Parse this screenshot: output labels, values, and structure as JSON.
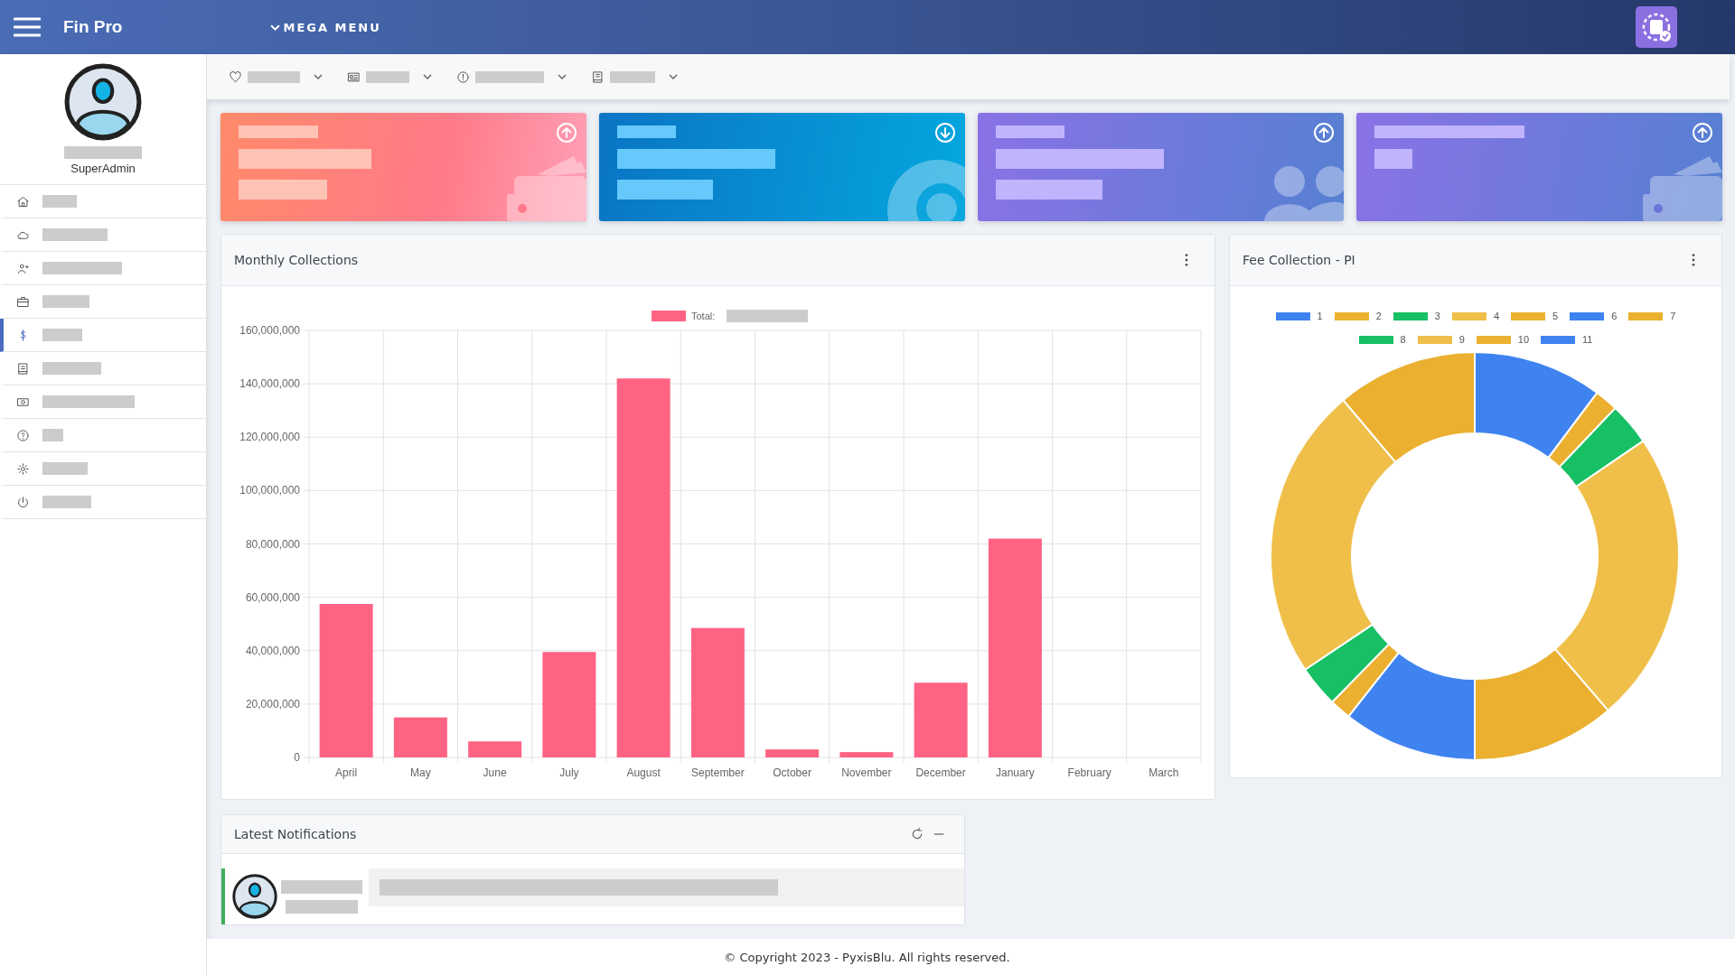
{
  "header": {
    "brand": "Fin Pro",
    "mega_menu": "MEGA MENU"
  },
  "profile": {
    "role": "SuperAdmin"
  },
  "sidebar": {
    "items": [
      {
        "selected": false
      },
      {
        "selected": false
      },
      {
        "selected": false
      },
      {
        "selected": false
      },
      {
        "selected": true
      },
      {
        "selected": false
      },
      {
        "selected": false
      },
      {
        "selected": false
      },
      {
        "selected": false
      },
      {
        "selected": false
      }
    ]
  },
  "cards": [
    {
      "up": true
    },
    {
      "up": false
    },
    {
      "up": true
    },
    {
      "up": true
    }
  ],
  "monthly_collections": {
    "title": "Monthly Collections",
    "chart_data": {
      "type": "bar",
      "categories": [
        "April",
        "May",
        "June",
        "July",
        "August",
        "September",
        "October",
        "November",
        "December",
        "January",
        "February",
        "March"
      ],
      "series": [
        {
          "name": "Total:",
          "color": "#ff6384",
          "values": [
            57500000,
            15000000,
            6000000,
            39500000,
            142000000,
            48500000,
            3000000,
            2000000,
            28000000,
            82000000,
            0,
            0
          ]
        }
      ],
      "ylim": [
        0,
        160000000
      ],
      "grid": true,
      "yticks": [
        {
          "value": 0,
          "label": "0"
        },
        {
          "value": 20000000,
          "label": "20,000,000"
        },
        {
          "value": 40000000,
          "label": "40,000,000"
        },
        {
          "value": 60000000,
          "label": "60,000,000"
        },
        {
          "value": 80000000,
          "label": "80,000,000"
        },
        {
          "value": 100000000,
          "label": "100,000,000"
        },
        {
          "value": 120000000,
          "label": "120,000,000"
        },
        {
          "value": 140000000,
          "label": "140,000,000"
        },
        {
          "value": 160000000,
          "label": "160,000,000"
        }
      ]
    }
  },
  "fee_collection": {
    "title": "Fee Collection - PI",
    "legend": [
      {
        "label": "1",
        "color": "#3f83f0"
      },
      {
        "label": "2",
        "color": "#ebb030"
      },
      {
        "label": "3",
        "color": "#17c064"
      },
      {
        "label": "4",
        "color": "#efbf4a"
      },
      {
        "label": "5",
        "color": "#ebb030"
      },
      {
        "label": "6",
        "color": "#3f83f0"
      },
      {
        "label": "7",
        "color": "#ebb030"
      },
      {
        "label": "8",
        "color": "#17c064"
      },
      {
        "label": "9",
        "color": "#efbf4a"
      },
      {
        "label": "10",
        "color": "#ebb030"
      },
      {
        "label": "11",
        "color": "#3f83f0"
      }
    ]
  },
  "notifications": {
    "title": "Latest Notifications"
  },
  "footer": "© Copyright 2023 - PyxisBlu. All rights reserved."
}
